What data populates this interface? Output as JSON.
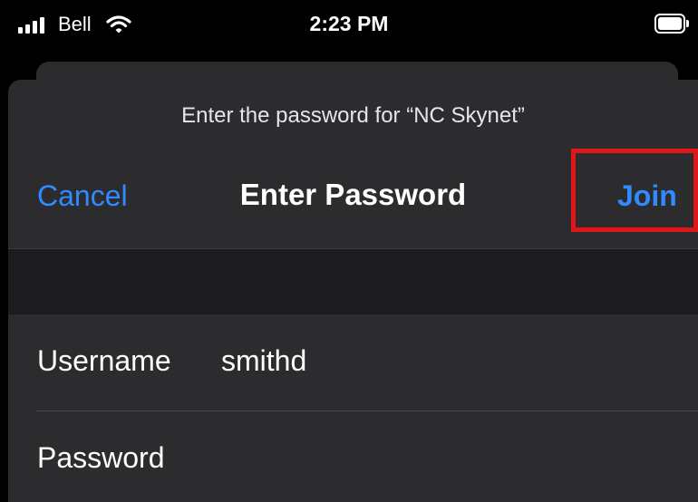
{
  "status_bar": {
    "carrier": "Bell",
    "time": "2:23 PM",
    "signal_icon": "cellular-signal-icon",
    "wifi_icon": "wifi-icon",
    "battery_icon": "battery-icon"
  },
  "dialog": {
    "prompt": "Enter the password for “NC Skynet”",
    "cancel_label": "Cancel",
    "title": "Enter Password",
    "join_label": "Join",
    "highlight_color": "#e0161b",
    "accent_color": "#2f8bff"
  },
  "form": {
    "username_label": "Username",
    "username_value": "smithd",
    "password_label": "Password",
    "password_value": ""
  }
}
